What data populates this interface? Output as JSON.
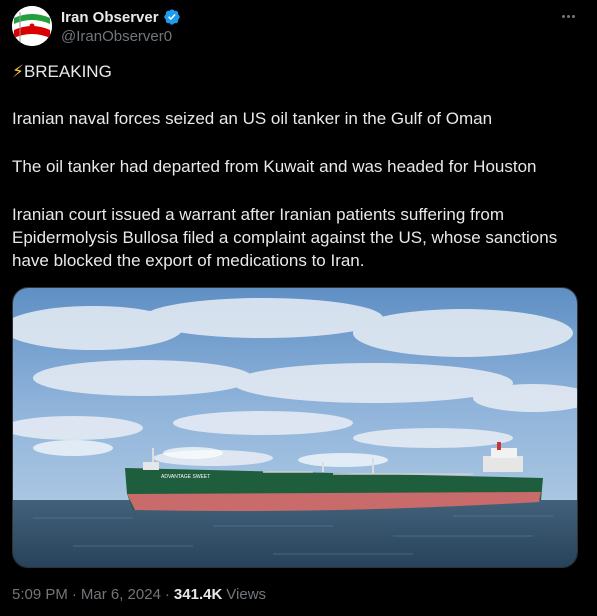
{
  "account": {
    "display_name": "Iran Observer",
    "handle": "@IranObserver0",
    "verified": true,
    "avatar_icon": "iran-flag-icon"
  },
  "post": {
    "breaking_prefix": "⚡",
    "breaking_label": "BREAKING",
    "paragraphs": [
      "Iranian naval forces seized an US oil tanker in the Gulf of Oman",
      "The oil tanker had departed from Kuwait and was headed for Houston",
      "Iranian court issued a warrant after Iranian patients suffering from Epidermolysis Bullosa filed a complaint against the US, whose sanctions have blocked the export of medications to Iran."
    ],
    "media": {
      "kind": "photo",
      "subject": "oil-tanker-at-sea",
      "ship_name": "ADVANTAGE SWEET"
    }
  },
  "meta": {
    "time": "5:09 PM",
    "separator": "·",
    "date": "Mar 6, 2024",
    "views_count": "341.4K",
    "views_label": "Views"
  },
  "colors": {
    "background": "#000000",
    "text": "#e7e9ea",
    "secondary_text": "#71767b",
    "verified_badge": "#1d9bf0"
  }
}
